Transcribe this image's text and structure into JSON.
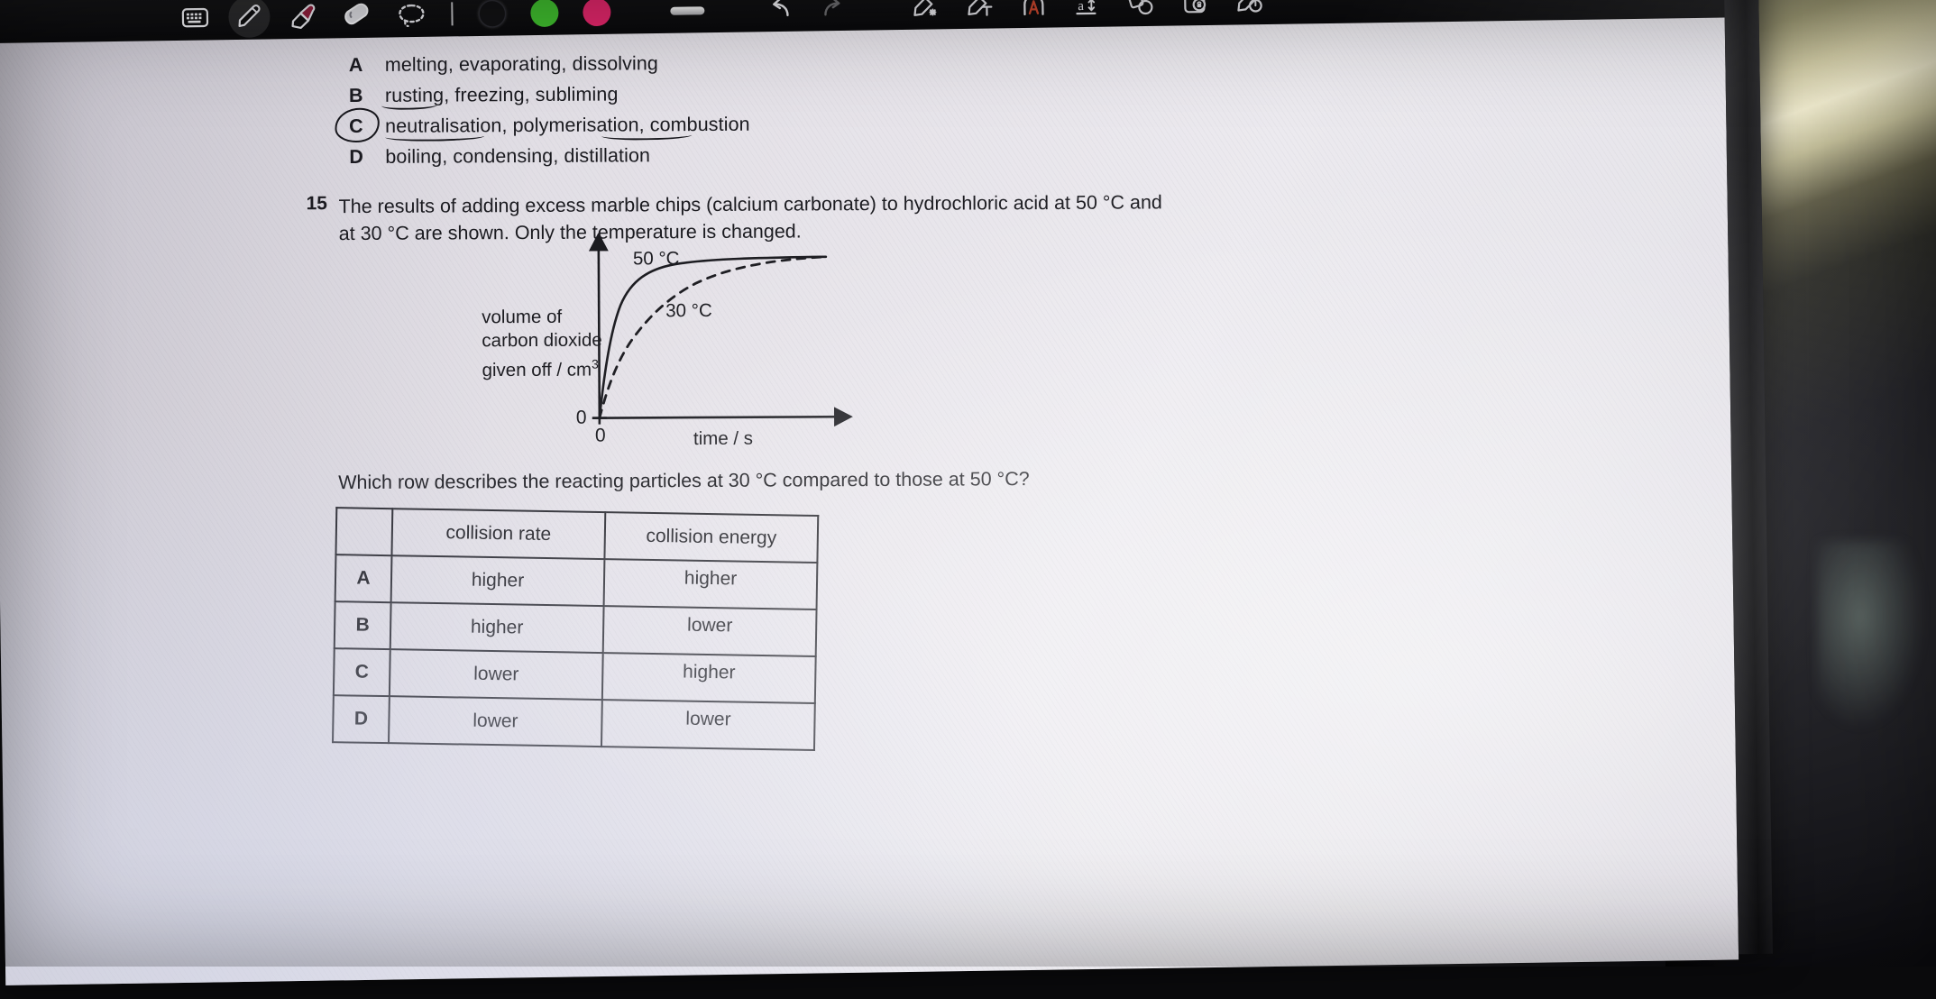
{
  "app": {
    "toolbar": {
      "tools": [
        {
          "id": "keyboard",
          "icon": "keyboard-icon",
          "label": "Keyboard",
          "selected": false
        },
        {
          "id": "pen",
          "icon": "pen-icon",
          "label": "Pen",
          "selected": true
        },
        {
          "id": "highlighter",
          "icon": "highlighter-icon",
          "label": "Highlighter",
          "selected": false
        },
        {
          "id": "eraser",
          "icon": "eraser-icon",
          "label": "Eraser",
          "selected": false
        },
        {
          "id": "lasso",
          "icon": "lasso-select-icon",
          "label": "Lasso select",
          "selected": false
        }
      ],
      "colors": [
        {
          "id": "black",
          "name": "black-color-swatch",
          "hex": "#121214",
          "selected": false
        },
        {
          "id": "green",
          "name": "green-color-swatch",
          "hex": "#3fbb2e",
          "selected": false
        },
        {
          "id": "pink",
          "name": "pink-color-swatch",
          "hex": "#e0266a",
          "selected": false
        }
      ],
      "stroke_width": {
        "label": "Stroke thickness"
      },
      "actions": [
        {
          "id": "undo",
          "icon": "undo-icon",
          "label": "Undo",
          "enabled": true
        },
        {
          "id": "redo",
          "icon": "redo-icon",
          "label": "Redo",
          "enabled": false
        },
        {
          "id": "ink-to-shape",
          "icon": "ink-to-shape-icon",
          "label": "Ink to shape",
          "enabled": true
        },
        {
          "id": "ink-to-text",
          "icon": "ink-to-text-icon",
          "label": "Ink to text",
          "enabled": true
        },
        {
          "id": "assistant",
          "icon": "assistant-icon",
          "label": "Assistant",
          "enabled": true,
          "hex": "#c8472e"
        },
        {
          "id": "text-size",
          "icon": "text-size-icon",
          "label": "Text size",
          "enabled": true
        },
        {
          "id": "shapes",
          "icon": "shapes-icon",
          "label": "Shapes",
          "enabled": true
        },
        {
          "id": "lock-page",
          "icon": "lock-page-icon",
          "label": "Lock page",
          "enabled": true
        },
        {
          "id": "settings-pen",
          "icon": "pen-settings-icon",
          "label": "Pen settings",
          "enabled": true
        }
      ]
    }
  },
  "document": {
    "options_block": {
      "items": [
        {
          "letter": "A",
          "text": "melting, evaporating, dissolving"
        },
        {
          "letter": "B",
          "text": "rusting, freezing, subliming"
        },
        {
          "letter": "C",
          "text": "neutralisation, polymerisation, combustion"
        },
        {
          "letter": "D",
          "text": "boiling, condensing, distillation"
        }
      ],
      "annotations": {
        "circled_option": "C",
        "underlined_words": [
          "rusting",
          "neutralisation",
          "combustion"
        ]
      }
    },
    "question": {
      "number": "15",
      "line1": "The results of adding excess marble chips (calcium carbonate) to hydrochloric acid at 50 °C and",
      "line2": "at 30 °C are shown. Only the temperature is changed.",
      "prompt": "Which row describes the reacting particles at 30 °C compared to those at 50 °C?"
    },
    "table": {
      "headers": [
        "",
        "collision rate",
        "collision energy"
      ],
      "rows": [
        {
          "letter": "A",
          "rate": "higher",
          "energy": "higher"
        },
        {
          "letter": "B",
          "rate": "higher",
          "energy": "lower"
        },
        {
          "letter": "C",
          "rate": "lower",
          "energy": "higher"
        },
        {
          "letter": "D",
          "rate": "lower",
          "energy": "lower"
        }
      ]
    }
  },
  "chart_data": {
    "type": "line",
    "title": "",
    "xlabel": "time / s",
    "ylabel": "volume of carbon dioxide given off / cm3",
    "ylabel_lines": [
      "volume of",
      "carbon dioxide",
      "given off / cm"
    ],
    "ylabel_superscript": "3",
    "x_origin_label": "0",
    "y_origin_label": "0",
    "xlim": [
      0,
      100
    ],
    "ylim": [
      0,
      100
    ],
    "grid": false,
    "legend": "inline-annotations",
    "series": [
      {
        "name": "50 °C",
        "style": "solid",
        "color": "#1b1b20",
        "annotation": "50 °C",
        "x": [
          0,
          3,
          6,
          9,
          12,
          16,
          20,
          26,
          32,
          40,
          50,
          62,
          75,
          88,
          100
        ],
        "y": [
          0,
          22,
          40,
          54,
          64,
          74,
          81,
          87,
          90.5,
          93,
          94.5,
          95.5,
          96,
          96.3,
          96.5
        ]
      },
      {
        "name": "30 °C",
        "style": "dashed",
        "color": "#1b1b20",
        "annotation": "30 °C",
        "x": [
          0,
          4,
          8,
          13,
          18,
          24,
          30,
          38,
          46,
          56,
          66,
          78,
          90,
          100
        ],
        "y": [
          0,
          14,
          26,
          39,
          50,
          60,
          68,
          77,
          83,
          88,
          91.5,
          94,
          95.5,
          96.3
        ]
      }
    ]
  }
}
